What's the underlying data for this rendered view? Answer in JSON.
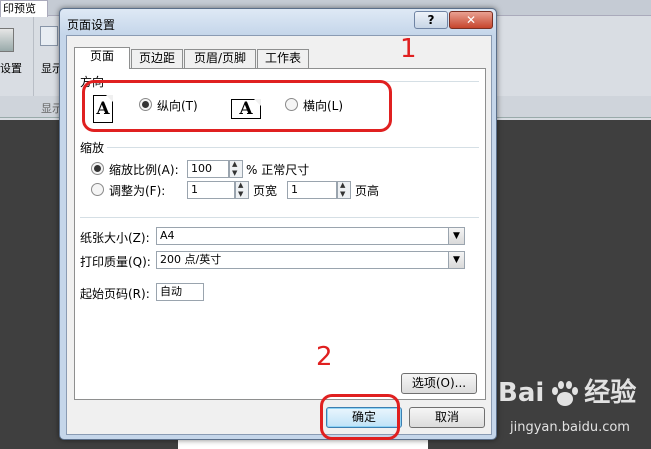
{
  "background": {
    "tab_label": "印预览",
    "group1_label": "设置",
    "group2_label": "显示",
    "group2_footer": "显示"
  },
  "dialog": {
    "title": "页面设置",
    "help_glyph": "?",
    "close_glyph": "✕",
    "tabs": [
      {
        "label": "页面",
        "active": true
      },
      {
        "label": "页边距",
        "active": false
      },
      {
        "label": "页眉/页脚",
        "active": false
      },
      {
        "label": "工作表",
        "active": false
      }
    ],
    "orientation": {
      "label": "方向",
      "icon_glyph": "A",
      "portrait_label": "纵向(T)",
      "landscape_label": "横向(L)",
      "selected": "portrait"
    },
    "scaling": {
      "label": "缩放",
      "scale_label": "缩放比例(A):",
      "scale_value": "100",
      "scale_unit": "% 正常尺寸",
      "fit_label": "调整为(F):",
      "fit_wide_value": "1",
      "fit_wide_unit": "页宽",
      "fit_tall_value": "1",
      "fit_tall_unit": "页高",
      "selected": "scale"
    },
    "paper_size": {
      "label": "纸张大小(Z):",
      "value": "A4"
    },
    "print_quality": {
      "label": "打印质量(Q):",
      "value": "200 点/英寸"
    },
    "first_page": {
      "label": "起始页码(R):",
      "value": "自动"
    },
    "options_button": "选项(O)...",
    "ok_button": "确定",
    "cancel_button": "取消"
  },
  "annotations": {
    "step1": "1",
    "step2": "2",
    "color": "#e02020"
  },
  "watermark": {
    "brand": "Bai du",
    "brand_left": "Bai",
    "brand_right": "经验",
    "url": "jingyan.baidu.com"
  }
}
